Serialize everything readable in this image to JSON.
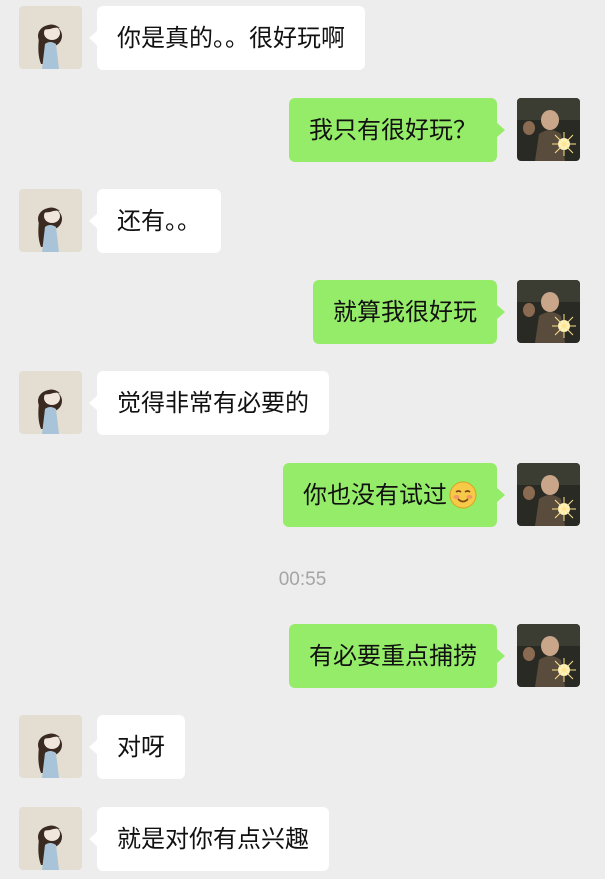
{
  "conversation": {
    "messages": [
      {
        "side": "in",
        "text": "你是真的。。很好玩啊"
      },
      {
        "side": "out",
        "text": "我只有很好玩？"
      },
      {
        "side": "in",
        "text": "还有。。"
      },
      {
        "side": "out",
        "text": "就算我很好玩"
      },
      {
        "side": "in",
        "text": "觉得非常有必要的"
      },
      {
        "side": "out",
        "text": "你也没有试过",
        "emoji": "blushing-smile-emoji"
      },
      {
        "side": "out",
        "text": "有必要重点捕捞"
      },
      {
        "side": "in",
        "text": "对呀"
      },
      {
        "side": "in",
        "text": "就是对你有点兴趣"
      }
    ],
    "timestamp": "00:55"
  },
  "colors": {
    "background": "#ededed",
    "incoming_bubble": "#ffffff",
    "outgoing_bubble": "#95ec69",
    "timestamp_text": "#a5a5a5"
  }
}
